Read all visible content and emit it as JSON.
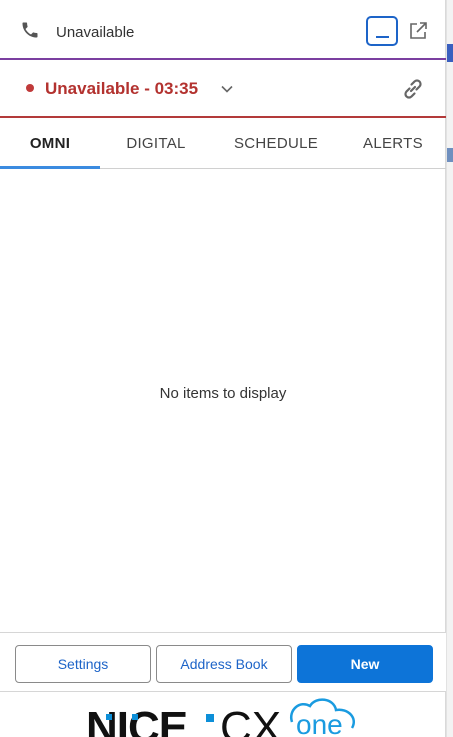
{
  "header": {
    "status_label": "Unavailable",
    "phone_icon": "phone-icon",
    "minimize_icon": "minimize-icon",
    "popout_icon": "popout-icon"
  },
  "status": {
    "label": "Unavailable - 03:35",
    "color": "#b3322f",
    "dropdown_icon": "chevron-down-icon",
    "link_icon": "link-icon"
  },
  "tabs": [
    {
      "label": "OMNI",
      "active": true
    },
    {
      "label": "DIGITAL",
      "active": false
    },
    {
      "label": "SCHEDULE",
      "active": false
    },
    {
      "label": "ALERTS",
      "active": false
    }
  ],
  "content": {
    "empty_message": "No items to display"
  },
  "footer": {
    "settings_label": "Settings",
    "address_book_label": "Address Book",
    "new_label": "New"
  },
  "logo": {
    "text_left": "NICE",
    "text_mid": "CX",
    "text_right": "one"
  },
  "colors": {
    "accent": "#0d74d8",
    "header_border": "#7b3fa0",
    "status_border": "#b33a3a",
    "tab_indicator": "#3b8be0"
  }
}
